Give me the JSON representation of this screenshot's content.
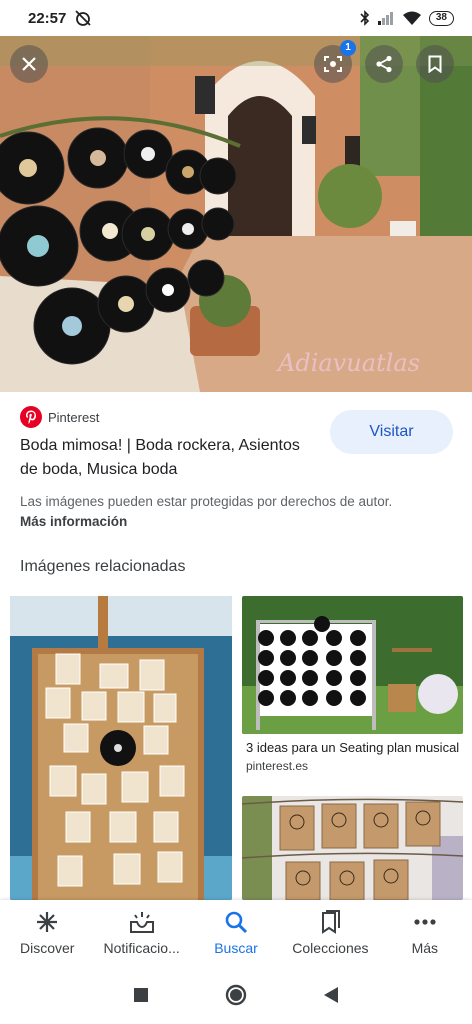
{
  "status_bar": {
    "time": "22:57",
    "battery": "38"
  },
  "hero": {
    "lens_badge": "1",
    "watermark": "Adiavuatlas"
  },
  "source": {
    "name": "Pinterest",
    "brand_color": "#e60023"
  },
  "result": {
    "title": "Boda mimosa! | Boda rockera, Asientos de boda, Musica boda",
    "visit_label": "Visitar",
    "copyright_text": "Las imágenes pueden estar protegidas por derechos de autor.",
    "more_info": "Más información"
  },
  "related": {
    "heading": "Imágenes relacionadas",
    "items": [
      {
        "caption": "3 ideas para un Seating plan musical",
        "source": "pinterest.es"
      }
    ]
  },
  "bottom_nav": {
    "items": [
      {
        "label": "Discover",
        "icon": "asterisk-icon"
      },
      {
        "label": "Notificacio...",
        "icon": "inbox-icon"
      },
      {
        "label": "Buscar",
        "icon": "search-icon"
      },
      {
        "label": "Colecciones",
        "icon": "collections-icon"
      },
      {
        "label": "Más",
        "icon": "more-dots-icon"
      }
    ]
  },
  "colors": {
    "accent": "#1a73e8",
    "visit_bg": "#e8f0fe"
  }
}
